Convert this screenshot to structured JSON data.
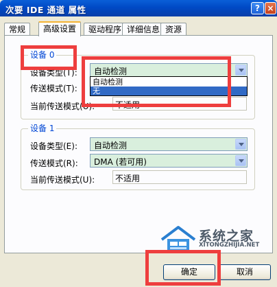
{
  "window": {
    "title": "次要 IDE 通道 属性",
    "help_button": "?",
    "close_button": "×"
  },
  "tabs": [
    {
      "label": "常规",
      "active": false
    },
    {
      "label": "高级设置",
      "active": true
    },
    {
      "label": "驱动程序",
      "active": false
    },
    {
      "label": "详细信息",
      "active": false
    },
    {
      "label": "资源",
      "active": false
    }
  ],
  "device0": {
    "group_label": "设备 0",
    "device_type_label": "设备类型(T):",
    "device_type_value": "自动检测",
    "transfer_mode_label": "传送模式(T):",
    "current_mode_label": "当前传送模式(U):",
    "current_mode_value": "不适用",
    "dropdown_options": [
      "自动检测",
      "无"
    ]
  },
  "device1": {
    "group_label": "设备 1",
    "device_type_label": "设备类型(E):",
    "device_type_value": "自动检测",
    "transfer_mode_label": "传送模式(R):",
    "transfer_mode_value": "DMA (若可用)",
    "current_mode_label": "当前传送模式(U):",
    "current_mode_value": "不适用"
  },
  "buttons": {
    "ok": "确定",
    "cancel": "取消"
  },
  "watermark": {
    "cn": "系统之家",
    "en": "XITONGZHIJIA.NET"
  },
  "colors": {
    "highlight": "#ee3e3e",
    "group_label": "#0046d5",
    "combo_bg": "#d9efdd",
    "selection": "#316ac5"
  }
}
